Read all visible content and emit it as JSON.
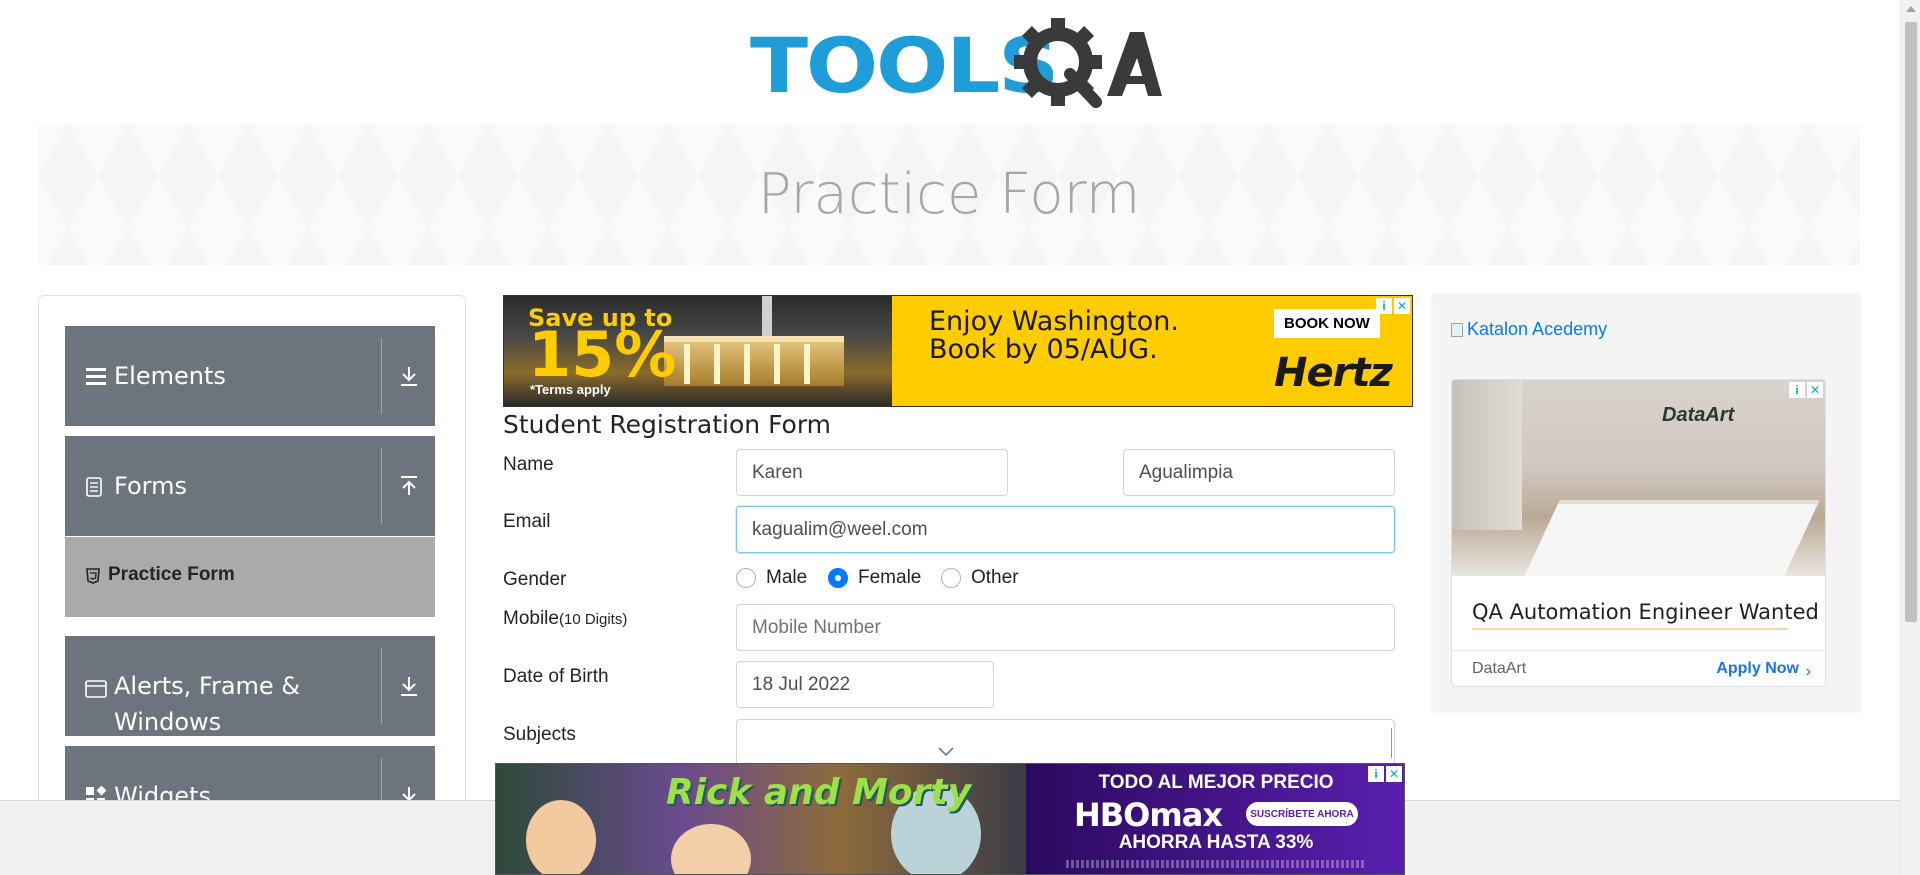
{
  "header": {
    "logo_alt": "TOOLSQA",
    "logo_tools": "TOOLS"
  },
  "banner": {
    "title": "Practice Form"
  },
  "sidebar": {
    "groups": [
      {
        "label": "Elements",
        "icon": "menu-icon",
        "arrow": "download-icon"
      },
      {
        "label": "Forms",
        "icon": "document-icon",
        "arrow": "upload-icon"
      },
      {
        "label": "Alerts, Frame & Windows",
        "icon": "window-icon",
        "arrow": "download-icon"
      },
      {
        "label": "Widgets",
        "icon": "widgets-icon",
        "arrow": "download-icon"
      }
    ],
    "active_item": {
      "label": "Practice Form",
      "icon": "html5-icon"
    }
  },
  "top_ad": {
    "save": "Save up to",
    "percent": "15%",
    "terms": "*Terms apply",
    "headline": "Enjoy Washington. Book by 05/AUG.",
    "cta": "BOOK NOW",
    "brand": "Hertz"
  },
  "form": {
    "title": "Student Registration Form",
    "labels": {
      "name": "Name",
      "email": "Email",
      "gender": "Gender",
      "mobile": "Mobile",
      "mobile_hint": "(10 Digits)",
      "dob": "Date of Birth",
      "subjects": "Subjects"
    },
    "first_name": "Karen",
    "last_name": "Agualimpia",
    "email": "kagualim@weel.com",
    "mobile_placeholder": "Mobile Number",
    "dob": "18 Jul 2022",
    "gender_options": [
      "Male",
      "Female",
      "Other"
    ],
    "gender_selected": "Female"
  },
  "side_ad": {
    "link_text": "Katalon Acedemy",
    "card": {
      "image_logo": "DataArt",
      "headline": "QA Automation Engineer Wanted",
      "advertiser": "DataArt",
      "cta": "Apply Now"
    }
  },
  "bottom_ad": {
    "show_title": "Rick and Morty",
    "line1": "TODO AL MEJOR PRECIO",
    "brand": "HBOmax",
    "pill": "SUSCRÍBETE AHORA",
    "line2": "AHORRA HASTA 33%"
  },
  "colors": {
    "logo_blue": "#1e9dd8",
    "logo_dark": "#3a3a3a",
    "sidebar_bg": "#6c757d",
    "active_item_bg": "#aaaaaa",
    "radio_checked": "#007bff",
    "ad_yellow": "#ffcc00"
  }
}
